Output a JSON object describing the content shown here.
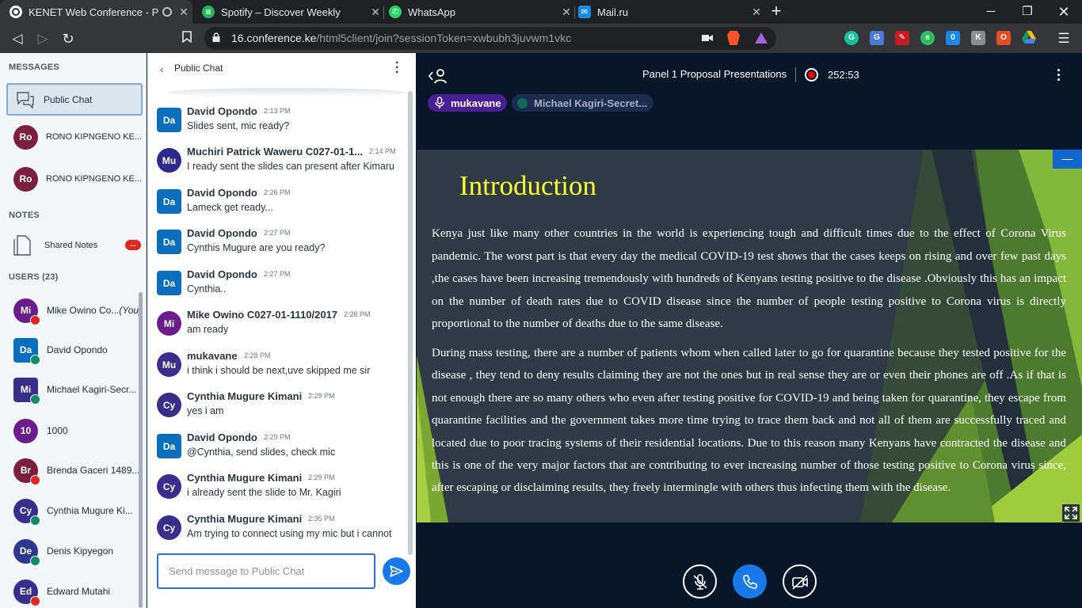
{
  "browser": {
    "tabs": [
      {
        "title": "KENET Web Conference - Panel",
        "favicon": "kenet-icon",
        "color": "#1a1a1a",
        "active": true
      },
      {
        "title": "Spotify – Discover Weekly",
        "favicon": "spotify-icon",
        "color": "#1db954",
        "active": false
      },
      {
        "title": "WhatsApp",
        "favicon": "whatsapp-icon",
        "color": "#25d366",
        "active": false
      },
      {
        "title": "Mail.ru",
        "favicon": "mailru-icon",
        "color": "#168de2",
        "active": false
      }
    ],
    "url_host": "16.conference.ke",
    "url_path": "/html5client/join?sessionToken=xwbubh3juvwm1vkc"
  },
  "left": {
    "messages_heading": "MESSAGES",
    "public_chat_label": "Public Chat",
    "private_chats": [
      {
        "initials": "Ro",
        "name": "RONO KIPNGENO KE..."
      },
      {
        "initials": "Ro",
        "name": "RONO KIPNGENO KE..."
      }
    ],
    "notes_heading": "NOTES",
    "shared_notes_label": "Shared Notes",
    "shared_notes_badge": "...",
    "users_heading": "USERS (23)",
    "users": [
      {
        "initials": "Mi",
        "name": "Mike Owino Co...",
        "suffix": "(You)",
        "color": "#6b1e8a",
        "status": "muted",
        "square": false
      },
      {
        "initials": "Da",
        "name": "David Opondo",
        "suffix": "",
        "color": "#0a6ebd",
        "status": "listen",
        "square": true
      },
      {
        "initials": "Mi",
        "name": "Michael Kagiri-Secr...",
        "suffix": "",
        "color": "#3a2e8c",
        "status": "listen",
        "square": true
      },
      {
        "initials": "10",
        "name": "1000",
        "suffix": "",
        "color": "#6b1e8a",
        "status": "",
        "square": false
      },
      {
        "initials": "Br",
        "name": "Brenda Gaceri 1489...",
        "suffix": "",
        "color": "#7a1f3d",
        "status": "muted",
        "square": false
      },
      {
        "initials": "Cy",
        "name": "Cynthia Mugure Ki...",
        "suffix": "",
        "color": "#3a2e8c",
        "status": "listen",
        "square": false
      },
      {
        "initials": "De",
        "name": "Denis Kipyegon",
        "suffix": "",
        "color": "#2d3a8c",
        "status": "listen",
        "square": false
      },
      {
        "initials": "Ed",
        "name": "Edward Mutahi",
        "suffix": "",
        "color": "#3a2e8c",
        "status": "muted",
        "square": false
      }
    ]
  },
  "chat": {
    "title": "Public Chat",
    "messages": [
      {
        "initials": "Da",
        "color": "#0a6ebd",
        "square": true,
        "sender": "David Opondo",
        "time": "2:13 PM",
        "text": "Slides sent, mic ready?"
      },
      {
        "initials": "Mu",
        "color": "#2d2a8c",
        "square": false,
        "sender": "Muchiri Patrick Waweru C027-01-1...",
        "time": "2:14 PM",
        "text": "I ready sent the slides can present after Kimaru"
      },
      {
        "initials": "Da",
        "color": "#0a6ebd",
        "square": true,
        "sender": "David Opondo",
        "time": "2:26 PM",
        "text": "Lameck get ready..."
      },
      {
        "initials": "Da",
        "color": "#0a6ebd",
        "square": true,
        "sender": "David Opondo",
        "time": "2:27 PM",
        "text": "Cynthis Mugure are you ready?"
      },
      {
        "initials": "Da",
        "color": "#0a6ebd",
        "square": true,
        "sender": "David Opondo",
        "time": "2:27 PM",
        "text": "Cynthia.."
      },
      {
        "initials": "Mi",
        "color": "#6b1e8a",
        "square": false,
        "sender": "Mike Owino C027-01-1110/2017",
        "time": "2:28 PM",
        "text": "am ready"
      },
      {
        "initials": "Mu",
        "color": "#3a2e8c",
        "square": false,
        "sender": "mukavane",
        "time": "2:28 PM",
        "text": "i think i should be next,uve skipped me sir"
      },
      {
        "initials": "Cy",
        "color": "#3a2e8c",
        "square": false,
        "sender": "Cynthia Mugure Kimani",
        "time": "2:29 PM",
        "text": "yes i am"
      },
      {
        "initials": "Da",
        "color": "#0a6ebd",
        "square": true,
        "sender": "David Opondo",
        "time": "2:29 PM",
        "text": "@Cynthia, send slides, check mic"
      },
      {
        "initials": "Cy",
        "color": "#3a2e8c",
        "square": false,
        "sender": "Cynthia Mugure Kimani",
        "time": "2:29 PM",
        "text": "i already sent the slide to Mr. Kagiri"
      },
      {
        "initials": "Cy",
        "color": "#3a2e8c",
        "square": false,
        "sender": "Cynthia Mugure Kimani",
        "time": "2:35 PM",
        "text": "Am trying to connect using my mic but i cannot"
      }
    ],
    "input_placeholder": "Send message to Public Chat"
  },
  "main": {
    "meeting_title": "Panel 1 Proposal Presentations",
    "recording_time": "252:53",
    "talkers": [
      {
        "name": "mukavane",
        "talking": true
      },
      {
        "name": "Michael Kagiri-Secret...",
        "talking": false
      }
    ],
    "slide": {
      "title": "Introduction",
      "paragraph1": "Kenya just like many other countries in the world is experiencing tough and difficult times due to the effect of Corona Virus pandemic. The worst part is that every day the medical COVID-19 test shows that the cases keeps on rising and over few past days ,the cases have been increasing tremendously with hundreds of Kenyans testing positive to the disease .Obviously this has an impact on the number of death rates due to COVID disease since the number of people testing positive to Corona virus is directly proportional to the number of deaths due to the same disease.",
      "paragraph2": "During mass testing, there are a number of patients whom when called later to go for quarantine because they tested positive for the disease , they tend to deny results claiming they are not the ones but in real sense they are or even their phones are off .As if that is not enough there are so many others who even after testing positive for COVID-19 and being taken for quarantine, they escape from quarantine facilities and the government takes more time trying to trace them back and not all of them are successfully traced and located due to poor tracing systems of their residential locations. Due to this reason many Kenyans have contracted the disease and this is one of the very major factors that are contributing to ever increasing number of those testing positive to Corona virus since, after escaping or disclaiming results, they freely intermingle with others thus infecting them with the disease."
    }
  }
}
